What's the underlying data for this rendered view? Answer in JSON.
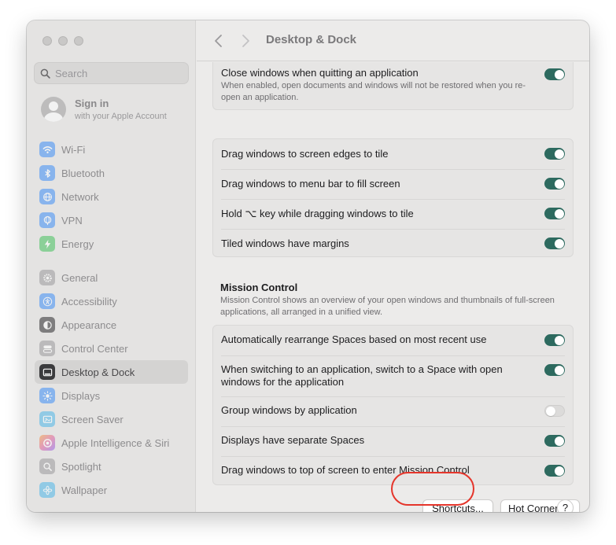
{
  "window": {
    "title": "Desktop & Dock"
  },
  "sidebar": {
    "search_placeholder": "Search",
    "account": {
      "name": "Sign in",
      "subtitle": "with your Apple Account"
    },
    "items": [
      {
        "label": "Wi-Fi",
        "icon": "wifi-icon",
        "color": "#3e8ef7"
      },
      {
        "label": "Bluetooth",
        "icon": "bluetooth-icon",
        "color": "#3e8ef7"
      },
      {
        "label": "Network",
        "icon": "globe-icon",
        "color": "#3e8ef7"
      },
      {
        "label": "VPN",
        "icon": "vpn-globe-icon",
        "color": "#3e8ef7"
      },
      {
        "label": "Energy",
        "icon": "energy-bolt-icon",
        "color": "#43c15c"
      },
      {
        "label": "General",
        "icon": "gear-icon",
        "color": "#9a9a9c"
      },
      {
        "label": "Accessibility",
        "icon": "accessibility-icon",
        "color": "#3e8ef7"
      },
      {
        "label": "Appearance",
        "icon": "appearance-icon",
        "color": "#2b2b2d"
      },
      {
        "label": "Control Center",
        "icon": "control-center-icon",
        "color": "#9a9a9c"
      },
      {
        "label": "Desktop & Dock",
        "icon": "dock-icon",
        "color": "#2b2b2d",
        "selected": true
      },
      {
        "label": "Displays",
        "icon": "sun-icon",
        "color": "#3e8ef7"
      },
      {
        "label": "Screen Saver",
        "icon": "screen-saver-icon",
        "color": "#4fb7e8"
      },
      {
        "label": "Apple Intelligence & Siri",
        "icon": "siri-icon",
        "color": "#e0609a"
      },
      {
        "label": "Spotlight",
        "icon": "magnifier-icon",
        "color": "#9a9a9c"
      },
      {
        "label": "Wallpaper",
        "icon": "flower-icon",
        "color": "#4fb7e8"
      }
    ]
  },
  "main": {
    "close_windows": {
      "label": "Close windows when quitting an application",
      "description": "When enabled, open documents and windows will not be restored when you re-open an application.",
      "on": true
    },
    "tiling": [
      {
        "label": "Drag windows to screen edges to tile",
        "on": true
      },
      {
        "label": "Drag windows to menu bar to fill screen",
        "on": true
      },
      {
        "label": "Hold ⌥ key while dragging windows to tile",
        "on": true
      },
      {
        "label": "Tiled windows have margins",
        "on": true
      }
    ],
    "mission_control": {
      "heading": "Mission Control",
      "description": "Mission Control shows an overview of your open windows and thumbnails of full-screen applications, all arranged in a unified view.",
      "rows": [
        {
          "label": "Automatically rearrange Spaces based on most recent use",
          "on": true
        },
        {
          "label": "When switching to an application, switch to a Space with open windows for the application",
          "on": true
        },
        {
          "label": "Group windows by application",
          "on": false
        },
        {
          "label": "Displays have separate Spaces",
          "on": true
        },
        {
          "label": "Drag windows to top of screen to enter Mission Control",
          "on": true
        }
      ]
    },
    "buttons": {
      "shortcuts": "Shortcuts...",
      "hot_corners": "Hot Corners...",
      "help": "?"
    }
  },
  "colors": {
    "toggle_on": "#2d6a5f",
    "highlight": "#e5352b"
  }
}
